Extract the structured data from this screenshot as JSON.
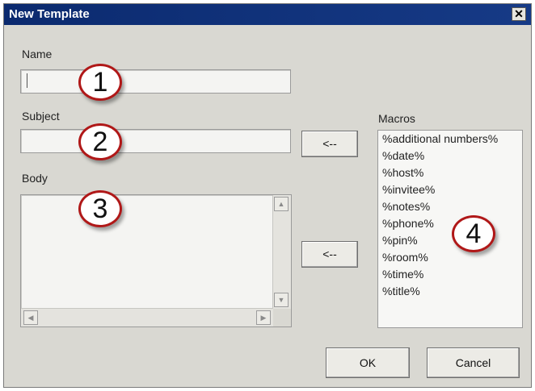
{
  "dialog": {
    "title": "New Template",
    "close_glyph": "✕"
  },
  "fields": {
    "name_label": "Name",
    "name_value": "",
    "subject_label": "Subject",
    "subject_value": "",
    "body_label": "Body",
    "body_value": ""
  },
  "macros": {
    "label": "Macros",
    "items": [
      "%additional numbers%",
      "%date%",
      "%host%",
      "%invitee%",
      "%notes%",
      "%phone%",
      "%pin%",
      "%room%",
      "%time%",
      "%title%"
    ]
  },
  "buttons": {
    "insert_subject": "<--",
    "insert_body": "<--",
    "ok": "OK",
    "cancel": "Cancel"
  },
  "callouts": [
    "1",
    "2",
    "3",
    "4"
  ],
  "icons": {
    "scroll_up": "▲",
    "scroll_down": "▼",
    "scroll_left": "◀",
    "scroll_right": "▶"
  }
}
